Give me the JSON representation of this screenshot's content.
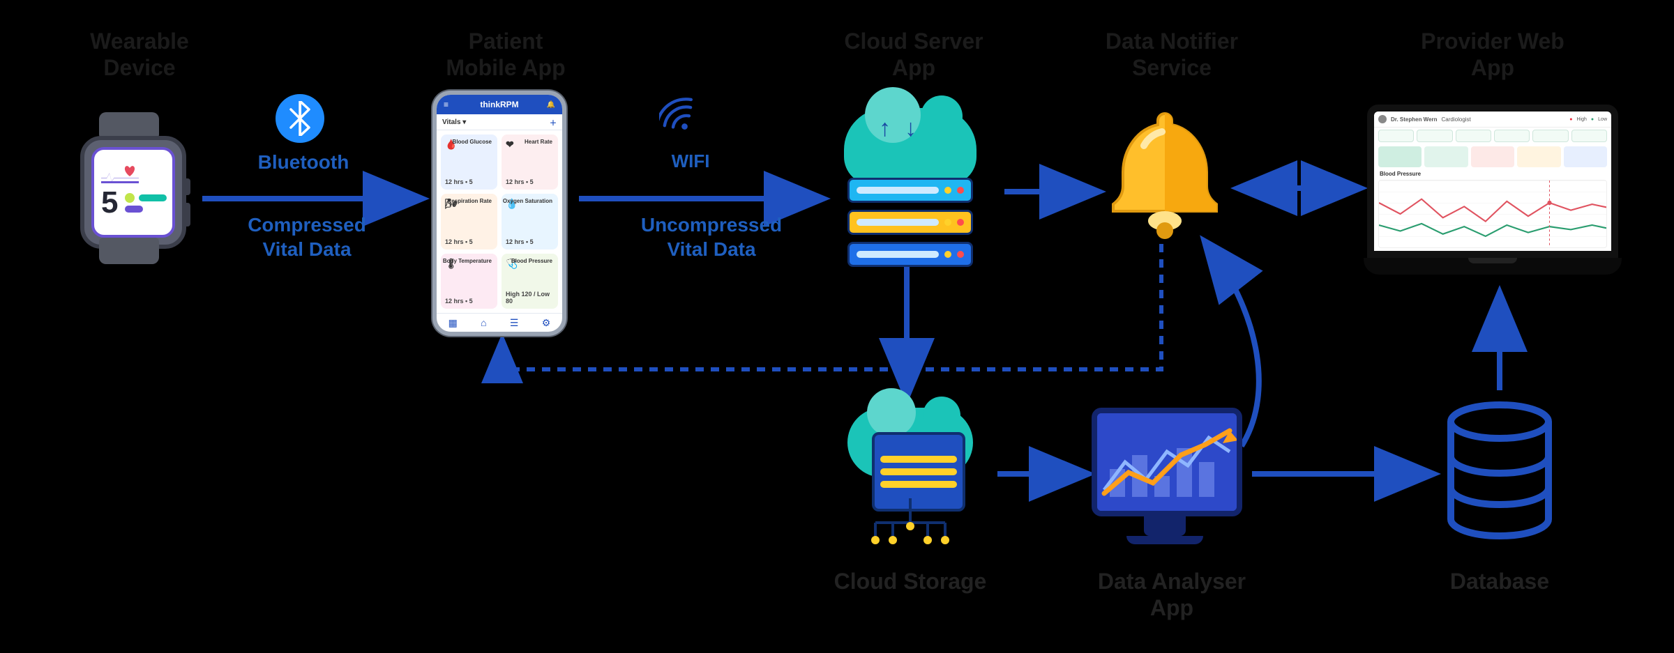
{
  "nodes": {
    "wearable": {
      "label_l1": "Wearable",
      "label_l2": "Device"
    },
    "mobile": {
      "label_l1": "Patient",
      "label_l2": "Mobile App",
      "app_title": "thinkRPM",
      "subbar_left": "Vitals ▾",
      "subbar_right": "＋",
      "tiles": [
        {
          "icon": "🩸",
          "title": "Blood Glucose",
          "sub": "12 hrs • 5"
        },
        {
          "icon": "❤",
          "title": "Heart Rate",
          "sub": "12 hrs • 5"
        },
        {
          "icon": "🌬",
          "title": "Respiration Rate",
          "sub": "12 hrs • 5"
        },
        {
          "icon": "💧",
          "title": "Oxygen Saturation",
          "sub": "12 hrs • 5"
        },
        {
          "icon": "🌡",
          "title": "Body Temperature",
          "sub": "12 hrs • 5"
        },
        {
          "icon": "🩺",
          "title": "Blood Pressure",
          "sub": "High 120 / Low 80"
        }
      ]
    },
    "cloudsrv": {
      "label_l1": "Cloud Server",
      "label_l2": "App"
    },
    "notifier": {
      "label_l1": "Data Notifier",
      "label_l2": "Service"
    },
    "webapp": {
      "label_l1": "Provider Web",
      "label_l2": "App",
      "hdr_name": "Dr. Stephen Wern",
      "hdr_role": "Cardiologist",
      "legend_a": "High",
      "legend_b": "Low",
      "chart_title": "Blood Pressure"
    },
    "cloudstore": {
      "label": "Cloud Storage"
    },
    "analyser": {
      "label_l1": "Data Analyser",
      "label_l2": "App"
    },
    "database": {
      "label": "Database"
    }
  },
  "edges": {
    "wearable_to_mobile": {
      "proto": "Bluetooth",
      "payload_l1": "Compressed",
      "payload_l2": "Vital Data"
    },
    "mobile_to_cloud": {
      "proto": "WIFI",
      "payload_l1": "Uncompressed",
      "payload_l2": "Vital Data"
    }
  },
  "watch_reading": "5"
}
